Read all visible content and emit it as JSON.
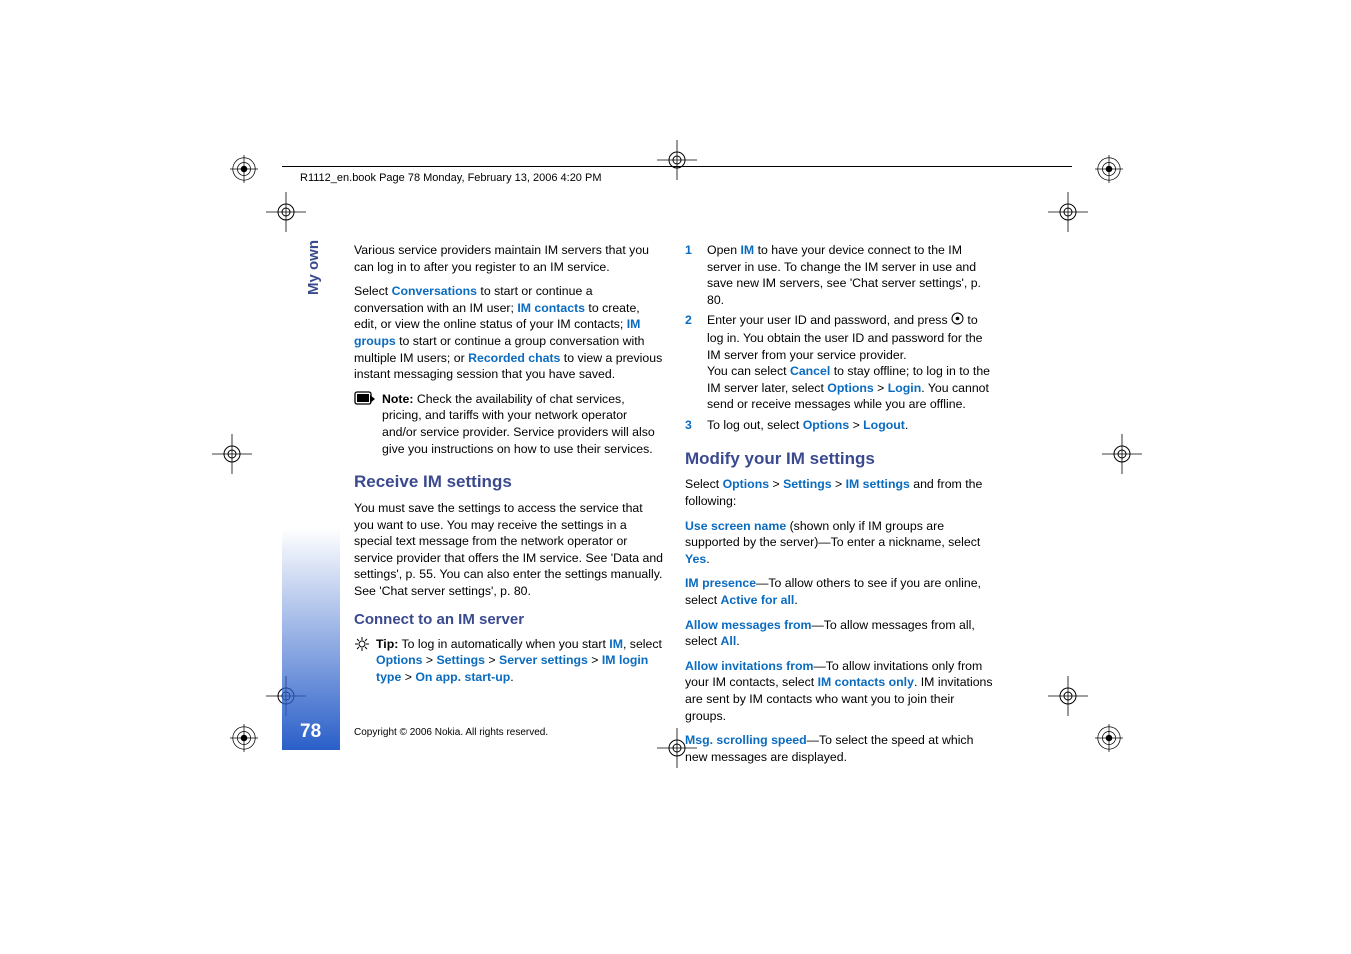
{
  "header": "R1112_en.book  Page 78  Monday, February 13, 2006  4:20 PM",
  "sideTab": "My own",
  "pageNumber": "78",
  "copyright": "Copyright © 2006 Nokia. All rights reserved.",
  "col1": {
    "p1_a": "Various service providers maintain IM servers that you can log in to after you register to an IM service.",
    "p2_select": "Select ",
    "p2_conversations": "Conversations",
    "p2_b": " to start or continue a conversation with an IM user; ",
    "p2_imcontacts": "IM contacts",
    "p2_c": " to create, edit, or view the online status of your IM contacts; ",
    "p2_imgroups": "IM groups",
    "p2_d": " to start or continue a group conversation with multiple IM users; or ",
    "p2_recorded": "Recorded chats",
    "p2_e": " to view a previous instant messaging session that you have saved.",
    "note_label": "Note:",
    "note_text": " Check the availability of chat services, pricing, and tariffs with your network operator and/or service provider. Service providers will also give you instructions on how to use their services.",
    "h_receive": "Receive IM settings",
    "p_receive": "You must save the settings to access the service that you want to use. You may receive the settings in a special text message from the network operator or service provider that offers the IM service. See 'Data and settings', p. 55. You can also enter the settings manually. See 'Chat server settings', p. 80.",
    "h_connect": "Connect to an IM server",
    "tip_label": "Tip:",
    "tip_a": " To log in automatically when you start ",
    "tip_im": "IM",
    "tip_b": ", select ",
    "tip_options": "Options",
    "tip_gt1": " > ",
    "tip_settings": "Settings",
    "tip_gt2": " > ",
    "tip_server": "Server settings",
    "tip_gt3": " > ",
    "tip_login": "IM login type",
    "tip_gt4": " > ",
    "tip_onapp": "On app. start-up",
    "tip_period": "."
  },
  "col2": {
    "li1_a": "Open ",
    "li1_im": "IM",
    "li1_b": " to have your device connect to the IM server in use. To change the IM server in use and save new IM servers, see 'Chat server settings', p. 80.",
    "li2_a": "Enter your user ID and password, and press ",
    "li2_b": " to log in. You obtain the user ID and password for the IM server from your service provider.",
    "li2_c": "You can select ",
    "li2_cancel": "Cancel",
    "li2_d": " to stay offline; to log in to the IM server later, select ",
    "li2_options": "Options",
    "li2_gt": " > ",
    "li2_login": "Login",
    "li2_e": ". You cannot send or receive messages while you are offline.",
    "li3_a": "To log out, select ",
    "li3_options": "Options",
    "li3_gt": " > ",
    "li3_logout": "Logout",
    "li3_period": ".",
    "h_modify": "Modify your IM settings",
    "pm_a": "Select ",
    "pm_options": "Options",
    "pm_gt1": " > ",
    "pm_settings": "Settings",
    "pm_gt2": " > ",
    "pm_imsettings": "IM settings",
    "pm_b": " and from the following:",
    "usn_label": "Use screen name",
    "usn_a": " (shown only if IM groups are supported by the server)—To enter a nickname, select ",
    "usn_yes": "Yes",
    "usn_period": ".",
    "imp_label": "IM presence",
    "imp_a": "—To allow others to see if you are online, select ",
    "imp_active": "Active for all",
    "imp_period": ".",
    "amf_label": "Allow messages from",
    "amf_a": "—To allow messages from all, select ",
    "amf_all": "All",
    "amf_period": ".",
    "aif_label": "Allow invitations from",
    "aif_a": "—To allow invitations only from your IM contacts, select ",
    "aif_only": "IM contacts only",
    "aif_b": ". IM invitations are sent by IM contacts who want you to join their groups.",
    "mss_label": "Msg. scrolling speed",
    "mss_a": "—To select the speed at which new messages are displayed."
  }
}
